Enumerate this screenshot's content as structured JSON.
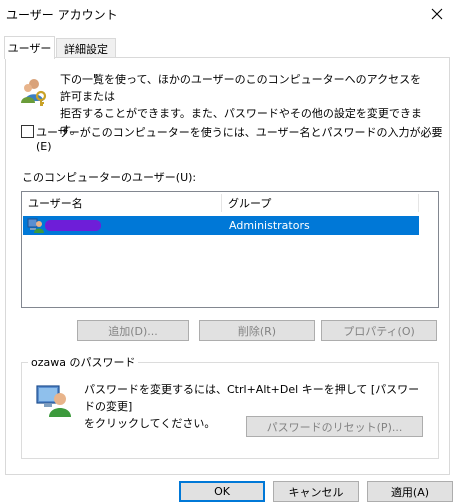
{
  "window": {
    "title": "ユーザー アカウント"
  },
  "tabs": [
    {
      "label": "ユーザー",
      "active": true
    },
    {
      "label": "詳細設定",
      "active": false
    }
  ],
  "users_tab": {
    "description_line1": "下の一覧を使って、ほかのユーザーのこのコンピューターへのアクセスを許可または",
    "description_line2": "拒否することができます。また、パスワードやその他の設定を変更できます。",
    "require_login_label": "ユーザーがこのコンピューターを使うには、ユーザー名とパスワードの入力が必要(E)",
    "require_login_checked": false,
    "users_list_label": "このコンピューターのユーザー(U):",
    "columns": [
      "ユーザー名",
      "グループ"
    ],
    "rows": [
      {
        "username": "",
        "group": "Administrators",
        "selected": true
      }
    ],
    "buttons": {
      "add": "追加(D)...",
      "remove": "削除(R)",
      "properties": "プロパティ(O)"
    },
    "password_group": {
      "title": "ozawa のパスワード",
      "text_line1": "パスワードを変更するには、Ctrl+Alt+Del キーを押して [パスワードの変更]",
      "text_line2": "をクリックしてください。",
      "reset_button": "パスワードのリセット(P)..."
    }
  },
  "dialog_buttons": {
    "ok": "OK",
    "cancel": "キャンセル",
    "apply": "適用(A)"
  },
  "colors": {
    "selection": "#0078d7",
    "focus_border": "#0078d7",
    "disabled_text": "#838383",
    "button_face": "#e1e1e1"
  },
  "icons": {
    "users_header": "users-key-icon",
    "user_row": "user-icon",
    "password": "user-keyboard-icon",
    "close": "close-icon"
  }
}
